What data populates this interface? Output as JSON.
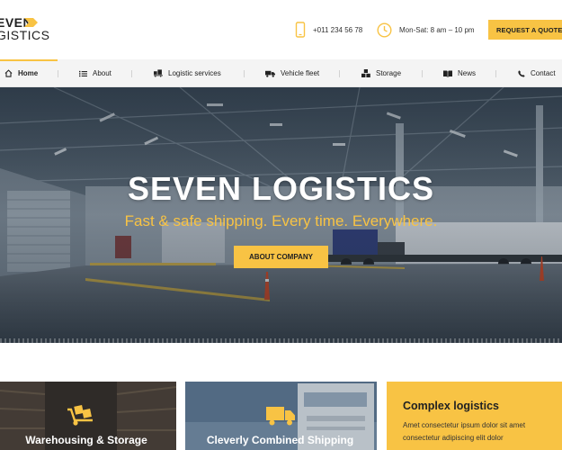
{
  "brand": {
    "line1": "EVEN",
    "line2": "GISTICS",
    "accent": "#f8c344"
  },
  "header": {
    "phone": "+011 234 56 78",
    "hours": "Mon-Sat: 8 am – 10 pm",
    "quote_label": "REQUEST A QUOTE"
  },
  "nav": {
    "items": [
      {
        "label": "Home",
        "icon": "home-icon",
        "active": true
      },
      {
        "label": "About",
        "icon": "list-icon"
      },
      {
        "label": "Logistic services",
        "icon": "boxes-truck-icon"
      },
      {
        "label": "Vehicle fleet",
        "icon": "truck-icon"
      },
      {
        "label": "Storage",
        "icon": "boxes-icon"
      },
      {
        "label": "News",
        "icon": "book-icon"
      },
      {
        "label": "Contact",
        "icon": "phone-icon"
      }
    ]
  },
  "hero": {
    "title": "SEVEN LOGISTICS",
    "subtitle": "Fast & safe shipping. Every time. Everywhere.",
    "button_label": "ABOUT COMPANY"
  },
  "cards": [
    {
      "title": "Warehousing & Storage",
      "icon": "hand-truck-icon"
    },
    {
      "title": "Cleverly Combined Shipping",
      "icon": "truck-icon"
    },
    {
      "title": "Complex logistics",
      "text": "Amet consectetur ipsum dolor sit amet consectetur adipiscing elit dolor"
    }
  ]
}
